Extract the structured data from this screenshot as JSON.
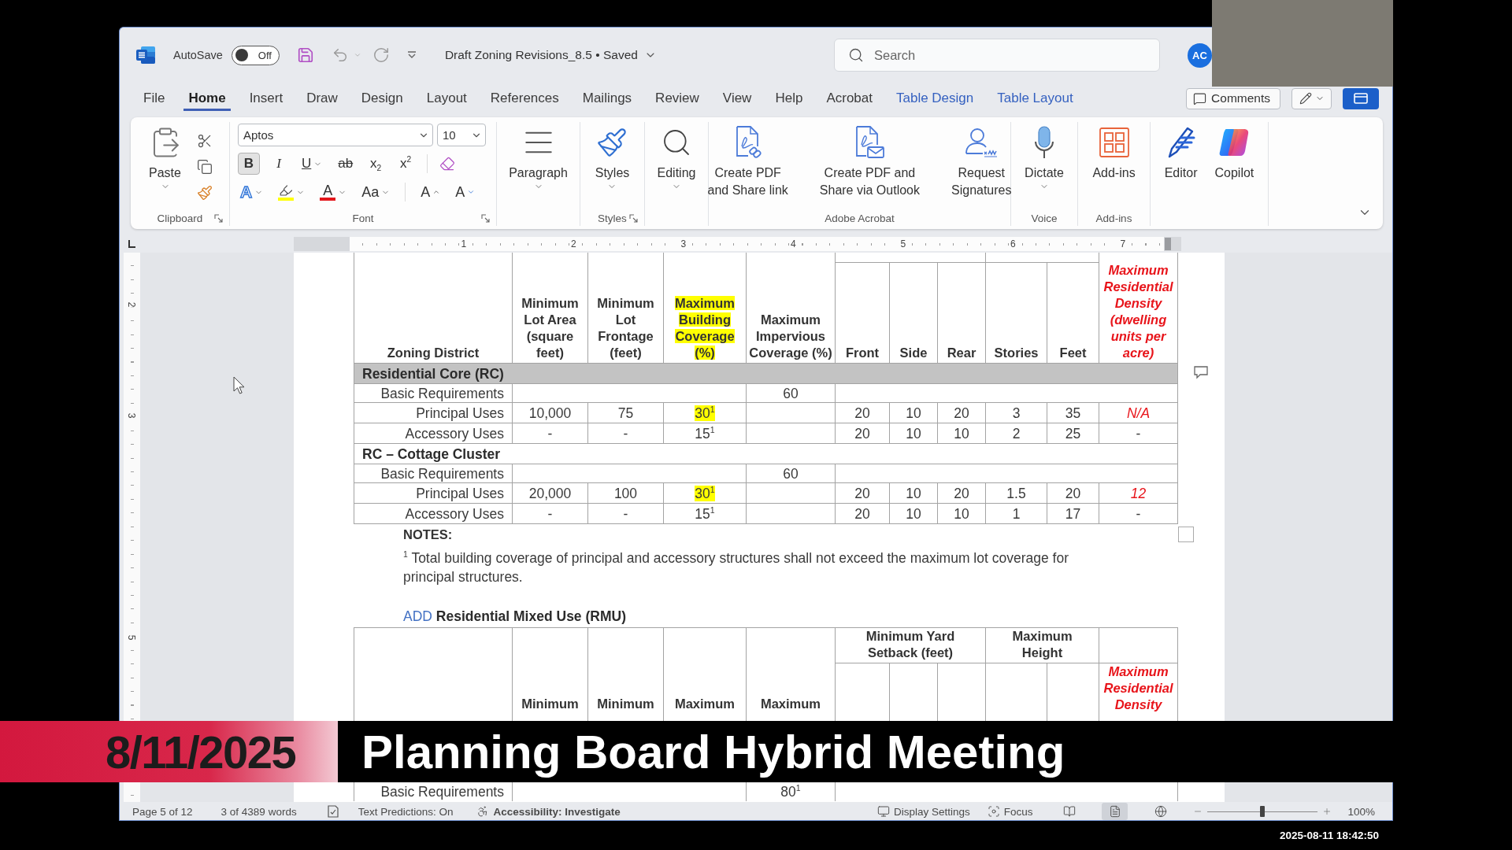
{
  "title_bar": {
    "autosave_label": "AutoSave",
    "autosave": {
      "on": false,
      "label": "Off"
    },
    "document_title": "Draft Zoning Revisions_8.5",
    "separator": "•",
    "save_status": "Saved",
    "search": {
      "placeholder": "Search"
    },
    "account_initials": "AC"
  },
  "ribbon_tabs": [
    {
      "label": "File",
      "kind": "standard",
      "selected": false
    },
    {
      "label": "Home",
      "kind": "standard",
      "selected": true
    },
    {
      "label": "Insert",
      "kind": "standard",
      "selected": false
    },
    {
      "label": "Draw",
      "kind": "standard",
      "selected": false
    },
    {
      "label": "Design",
      "kind": "standard",
      "selected": false
    },
    {
      "label": "Layout",
      "kind": "standard",
      "selected": false
    },
    {
      "label": "References",
      "kind": "standard",
      "selected": false
    },
    {
      "label": "Mailings",
      "kind": "standard",
      "selected": false
    },
    {
      "label": "Review",
      "kind": "standard",
      "selected": false
    },
    {
      "label": "View",
      "kind": "standard",
      "selected": false
    },
    {
      "label": "Help",
      "kind": "standard",
      "selected": false
    },
    {
      "label": "Acrobat",
      "kind": "standard",
      "selected": false
    },
    {
      "label": "Table Design",
      "kind": "contextual",
      "selected": false
    },
    {
      "label": "Table Layout",
      "kind": "contextual",
      "selected": false
    }
  ],
  "tab_bar_actions": {
    "comments": "Comments"
  },
  "ribbon": {
    "clipboard": {
      "group_label": "Clipboard",
      "launcher": true,
      "paste": {
        "label": "Paste",
        "dropdown": true
      }
    },
    "font": {
      "group_label": "Font",
      "launcher": true,
      "font_name": "Aptos",
      "font_size": "10",
      "format_buttons": [
        {
          "kind": "bold",
          "label": "B",
          "selected": true
        },
        {
          "kind": "italic",
          "label": "I",
          "selected": false
        },
        {
          "kind": "underline",
          "label": "U",
          "selected": false,
          "dropdown": true
        },
        {
          "kind": "strikethrough",
          "label": "ab",
          "selected": false
        },
        {
          "kind": "subscript",
          "label": "x$_{2}$",
          "selected": false
        },
        {
          "kind": "superscript",
          "label": "x$^{2}$",
          "selected": false
        }
      ],
      "effect_buttons": [
        {
          "kind": "text_effects",
          "label": "A",
          "dropdown": true
        },
        {
          "kind": "highlight",
          "color": "#ffff00",
          "dropdown": true
        },
        {
          "kind": "font_color",
          "label": "A",
          "color": "#e3161b",
          "dropdown": true
        },
        {
          "kind": "change_case",
          "label": "Aa",
          "dropdown": true
        },
        {
          "kind": "grow_font",
          "label": "A"
        },
        {
          "kind": "shrink_font",
          "label": "A"
        }
      ]
    },
    "groups": [
      {
        "buttons": [
          {
            "kind": "paragraph",
            "label": "Paragraph",
            "dropdown": true
          }
        ]
      },
      {
        "group_label": "Styles",
        "launcher": true,
        "buttons": [
          {
            "kind": "styles",
            "label": "Styles",
            "dropdown": true
          }
        ]
      },
      {
        "buttons": [
          {
            "kind": "editing",
            "label": "Editing",
            "dropdown": true
          }
        ]
      },
      {
        "group_label": "Adobe Acrobat",
        "buttons": [
          {
            "kind": "pdf_share_link",
            "label": "Create PDF\nand Share link"
          },
          {
            "kind": "pdf_share_outlook",
            "label": "Create PDF and\nShare via Outlook"
          },
          {
            "kind": "request_signatures",
            "label": "Request\nSignatures"
          }
        ]
      },
      {
        "group_label": "Voice",
        "buttons": [
          {
            "kind": "dictate",
            "label": "Dictate",
            "dropdown": true
          }
        ]
      },
      {
        "group_label": "Add-ins",
        "buttons": [
          {
            "kind": "add_ins",
            "label": "Add-ins"
          }
        ]
      },
      {
        "buttons": [
          {
            "kind": "editor",
            "label": "Editor"
          },
          {
            "kind": "copilot",
            "label": "Copilot"
          }
        ]
      }
    ]
  },
  "rulers": {
    "horizontal": [
      "1",
      "2",
      "3",
      "4",
      "5",
      "6",
      "7"
    ],
    "vertical": [
      "2",
      "3",
      "5"
    ]
  },
  "document": {
    "table_1": {
      "columns": [
        {
          "label": "Zoning District",
          "highlighted": false,
          "revision": false
        },
        {
          "label": "Minimum Lot Area (square feet)",
          "highlighted": false,
          "revision": false
        },
        {
          "label": "Minimum Lot Frontage (feet)",
          "highlighted": false,
          "revision": false
        },
        {
          "label": "Maximum Building Coverage (%)",
          "highlighted": true,
          "revision": false
        },
        {
          "label": "Maximum Impervious Coverage (%)",
          "highlighted": false,
          "revision": false
        },
        {
          "label": "Front",
          "highlighted": false,
          "revision": false
        },
        {
          "label": "Side",
          "highlighted": false,
          "revision": false
        },
        {
          "label": "Rear",
          "highlighted": false,
          "revision": false
        },
        {
          "label": "Stories",
          "highlighted": false,
          "revision": false
        },
        {
          "label": "Feet",
          "highlighted": false,
          "revision": false
        },
        {
          "label": "Maximum Residential Density (dwelling units per acre)",
          "highlighted": false,
          "revision": true
        }
      ],
      "rows": [
        {
          "kind": "section",
          "label": "Residential Core (RC)",
          "shaded": true,
          "comment": true
        },
        {
          "kind": "basic",
          "label": "Basic Requirements",
          "impervious": "60"
        },
        {
          "kind": "uses",
          "label": "Principal Uses",
          "cells": [
            "10,000",
            "75",
            {
              "text": "30$^{1}$",
              "highlighted": true,
              "revision": false
            },
            null,
            "20",
            "10",
            "20",
            "3",
            "35",
            {
              "text": "N/A",
              "highlighted": false,
              "revision": true
            }
          ]
        },
        {
          "kind": "uses",
          "label": "Accessory Uses",
          "cells": [
            "-",
            "-",
            "15$^{1}$",
            null,
            "20",
            "10",
            "10",
            "2",
            "25",
            "-"
          ]
        },
        {
          "kind": "section",
          "label": "RC – Cottage Cluster",
          "shaded": false,
          "comment": false
        },
        {
          "kind": "basic",
          "label": "Basic Requirements",
          "impervious": "60"
        },
        {
          "kind": "uses",
          "label": "Principal Uses",
          "cells": [
            "20,000",
            "100",
            {
              "text": "30$^{1}$",
              "highlighted": true,
              "revision": false
            },
            null,
            "20",
            "10",
            "20",
            "1.5",
            "20",
            {
              "text": "12",
              "highlighted": false,
              "revision": true
            }
          ]
        },
        {
          "kind": "uses",
          "label": "Accessory Uses",
          "cells": [
            "-",
            "-",
            "15$^{1}$",
            null,
            "20",
            "10",
            "10",
            "1",
            "17",
            "-"
          ]
        }
      ]
    },
    "notes": {
      "heading": "NOTES:",
      "text": "$^{1}$ Total building coverage of principal and accessory structures shall not exceed the maximum lot coverage for principal structures."
    },
    "section_heading": "ADD **Residential Mixed Use (RMU)**",
    "table_2": {
      "columns": [
        "Minimum",
        "Minimum",
        "Maximum",
        "Maximum"
      ],
      "group_headers": [
        "Minimum Yard Setback (feet)",
        "Maximum Height"
      ],
      "density_header": {
        "label": "Maximum Residential Density",
        "revision": true
      },
      "rows": [
        {
          "kind": "basic",
          "label": "Basic Requirements",
          "impervious": "80$^{1}$"
        }
      ]
    }
  },
  "banner": {
    "date": "8/11/2025",
    "title": "Planning Board Hybrid Meeting"
  },
  "status_bar": {
    "page": "Page 5 of 12",
    "words": "3 of 4389 words",
    "text_predictions": "Text Predictions: On",
    "accessibility": "Accessibility: Investigate",
    "display_settings": "Display Settings",
    "focus": "Focus",
    "views": [
      {
        "kind": "read",
        "selected": false
      },
      {
        "kind": "print",
        "selected": true
      },
      {
        "kind": "web",
        "selected": false
      }
    ],
    "zoom": {
      "level": 0.5,
      "reading": "100%"
    }
  },
  "timestamp": "2025-08-11 18:42:50"
}
